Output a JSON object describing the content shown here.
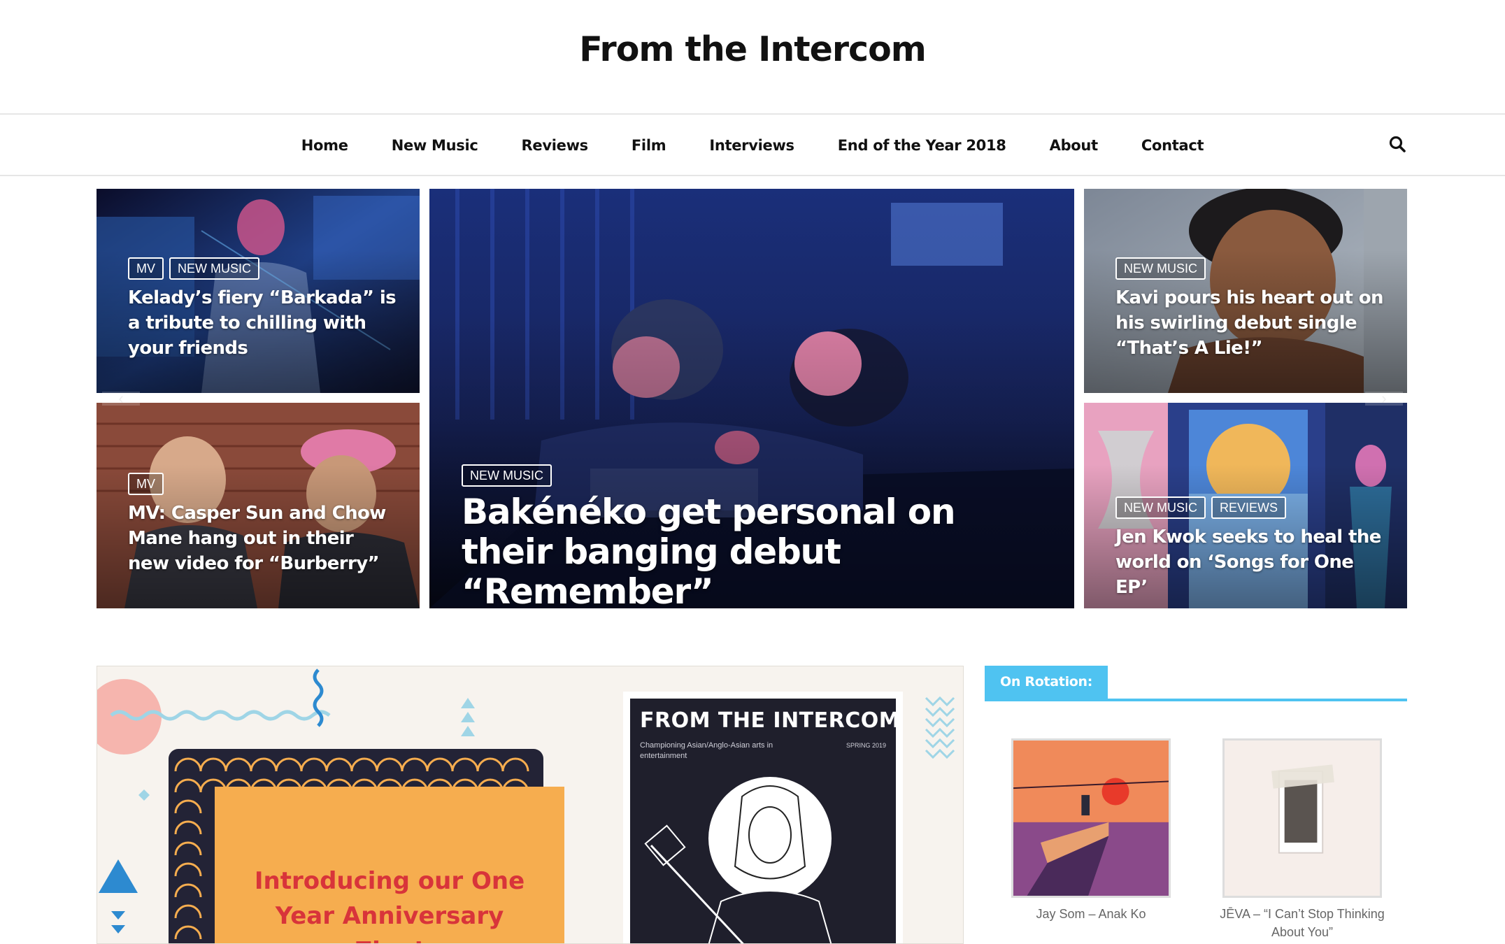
{
  "site": {
    "title": "From the Intercom"
  },
  "nav": {
    "items": [
      {
        "label": "Home"
      },
      {
        "label": "New Music"
      },
      {
        "label": "Reviews"
      },
      {
        "label": "Film"
      },
      {
        "label": "Interviews"
      },
      {
        "label": "End of the Year 2018"
      },
      {
        "label": "About"
      },
      {
        "label": "Contact"
      }
    ],
    "search_icon": "search-icon"
  },
  "featured": {
    "left_top": {
      "tags": [
        "MV",
        "NEW MUSIC"
      ],
      "title": "Kelady’s fiery “Barkada” is a tribute to chilling with your friends"
    },
    "left_bottom": {
      "tags": [
        "MV"
      ],
      "title": "MV: Casper Sun and Chow Mane hang out in their new video for “Burberry”"
    },
    "center": {
      "tags": [
        "NEW MUSIC"
      ],
      "title": "Bakénéko get personal on their banging debut “Remember”"
    },
    "right_top": {
      "tags": [
        "NEW MUSIC"
      ],
      "title": "Kavi pours his heart out on his swirling debut single “That’s A Lie!”"
    },
    "right_bottom": {
      "tags": [
        "NEW MUSIC",
        "REVIEWS"
      ],
      "title": "Jen Kwok seeks to heal the world on ‘Songs for One EP’"
    },
    "prev_icon": "chevron-left-icon",
    "next_icon": "chevron-right-icon"
  },
  "zine": {
    "headline": "Introducing our One Year Anniversary Zine!",
    "cover_title": "FROM THE INTERCOM",
    "cover_subtitle": "Championing Asian/Anglo-Asian arts in entertainment",
    "cover_season": "SPRING 2019"
  },
  "sidebar": {
    "widget_title": "On Rotation:",
    "albums": [
      {
        "caption": "Jay Som – Anak Ko"
      },
      {
        "caption": "JĒVA – “I Can’t Stop Thinking About You”"
      }
    ]
  },
  "colors": {
    "accent": "#4fc3f1",
    "zine_headline": "#d8343a",
    "zine_card": "#f6ad4f"
  }
}
